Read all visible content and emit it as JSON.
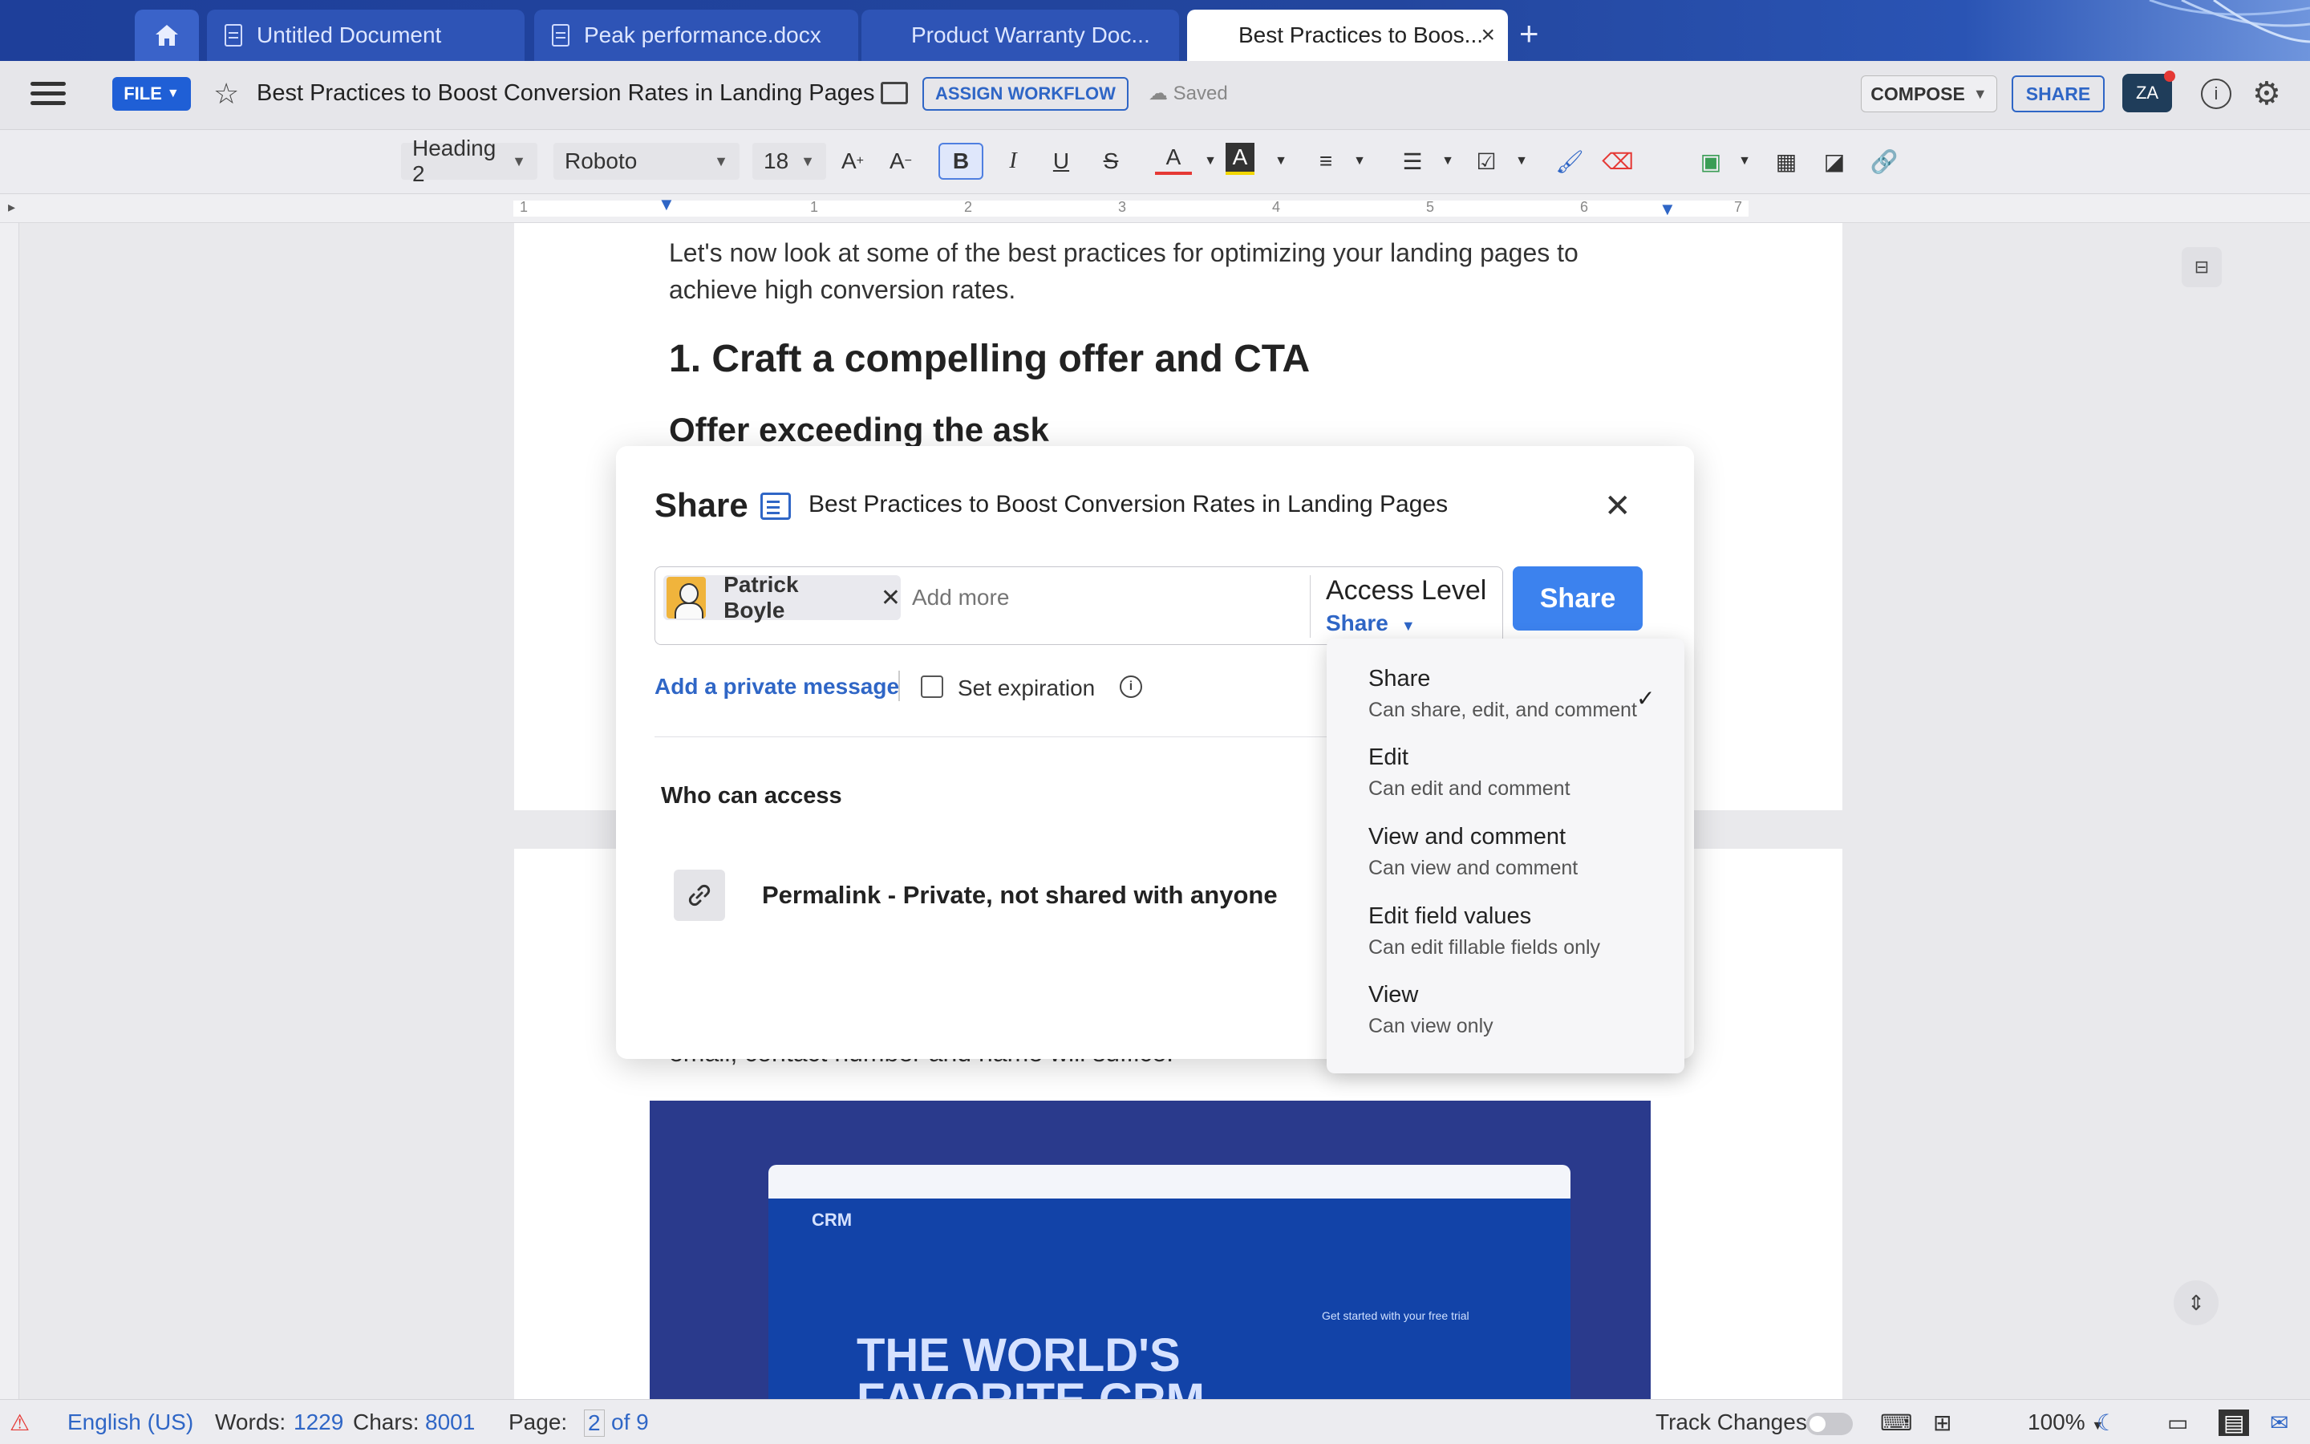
{
  "tabs": [
    {
      "label": "Untitled Document"
    },
    {
      "label": "Peak performance.docx"
    },
    {
      "label": "Product Warranty Doc..."
    },
    {
      "label": "Best Practices to Boos..."
    }
  ],
  "header": {
    "file_label": "FILE",
    "doc_title": "Best Practices to Boost Conversion Rates in Landing Pages",
    "assign_label": "ASSIGN WORKFLOW",
    "saved_label": "Saved",
    "compose_label": "COMPOSE",
    "share_label": "SHARE",
    "zia_label": "ZA"
  },
  "format": {
    "style": "Heading 2",
    "font": "Roboto",
    "size": "18"
  },
  "ruler": {
    "marks": [
      "1",
      "1",
      "2",
      "3",
      "4",
      "5",
      "6",
      "7"
    ]
  },
  "document": {
    "intro": "Let's now look at some of the best practices for optimizing your landing pages to achieve high conversion rates.",
    "heading1": "1. Craft a compelling offer and CTA",
    "heading2": "Offer exceeding the ask",
    "page2_line": "email, contact number and name will suffice.",
    "crm_banner": "THE WORLD'S FAVORITE CRM",
    "crm_brand": "CRM",
    "crm_trial": "Get started with your free trial"
  },
  "dialog": {
    "title": "Share",
    "doc_name": "Best Practices to Boost Conversion Rates in Landing Pages",
    "recipient": "Patrick Boyle",
    "add_more_placeholder": "Add more",
    "access_label": "Access Level",
    "access_value": "Share",
    "share_button": "Share",
    "private_message": "Add a private message",
    "set_expiration": "Set expiration",
    "who_can_access": "Who can access",
    "permalink": "Permalink - Private, not shared with anyone"
  },
  "access_options": [
    {
      "title": "Share",
      "desc": "Can share, edit, and comment",
      "selected": true
    },
    {
      "title": "Edit",
      "desc": "Can edit and comment",
      "selected": false
    },
    {
      "title": "View and comment",
      "desc": "Can view and comment",
      "selected": false
    },
    {
      "title": "Edit field values",
      "desc": "Can edit fillable fields only",
      "selected": false
    },
    {
      "title": "View",
      "desc": "Can view only",
      "selected": false
    }
  ],
  "status": {
    "language": "English (US)",
    "words_label": "Words:",
    "words": "1229",
    "chars_label": "Chars:",
    "chars": "8001",
    "page_label": "Page:",
    "page": "2",
    "page_of": "of 9",
    "track_changes": "Track Changes",
    "zoom": "100%"
  },
  "colors": {
    "accent": "#2f66c6",
    "share_button": "#3c82ee",
    "tabbar": "#23469e"
  }
}
